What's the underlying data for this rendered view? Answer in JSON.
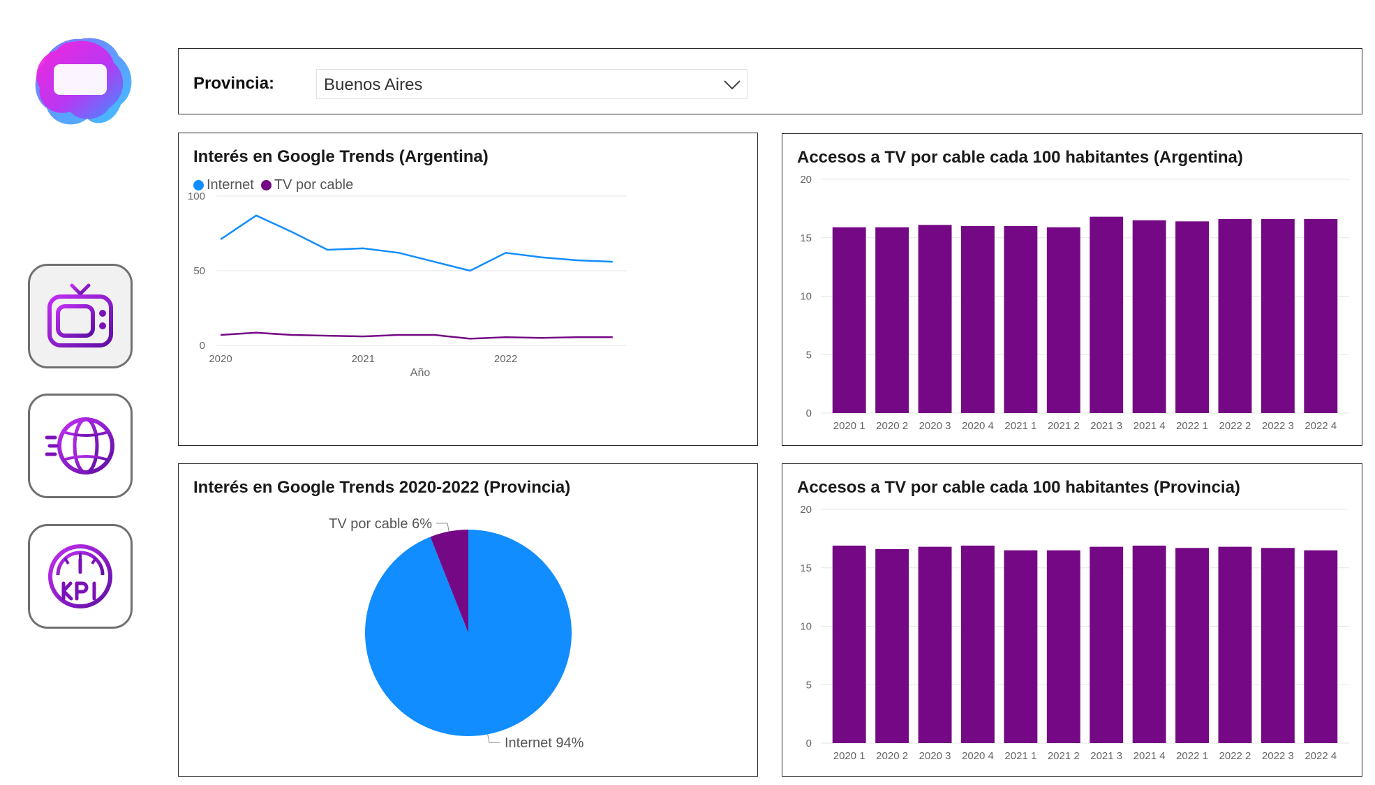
{
  "filter": {
    "label": "Provincia:",
    "selected": "Buenos Aires",
    "chevron_icon": "chevron-down-icon"
  },
  "nav": {
    "logo_icon": "app-logo",
    "items": [
      {
        "icon": "tv-icon",
        "active": true
      },
      {
        "icon": "globe-internet-icon",
        "active": false
      },
      {
        "icon": "kpi-gauge-icon",
        "active": false
      }
    ]
  },
  "colors": {
    "internet": "#118dff",
    "tv": "#750985",
    "accent_purple": "#8a1ec9"
  },
  "chart_data": [
    {
      "type": "line",
      "title": "Interés en Google Trends (Argentina)",
      "xlabel": "Año",
      "ylabel": "",
      "x_tick_labels": [
        "2020",
        "2021",
        "2022"
      ],
      "y_ticks": [
        0,
        50,
        100
      ],
      "ylim": [
        0,
        100
      ],
      "xlim": [
        2020,
        2022.8
      ],
      "legend": "top-left",
      "grid": true,
      "x": [
        2020,
        2020.25,
        2020.5,
        2020.75,
        2021,
        2021.25,
        2021.5,
        2021.75,
        2022,
        2022.25,
        2022.5,
        2022.75
      ],
      "series": [
        {
          "name": "Internet",
          "color": "#118dff",
          "values": [
            71,
            87,
            76,
            64,
            65,
            62,
            56,
            50,
            62,
            59,
            57,
            56
          ]
        },
        {
          "name": "TV por cable",
          "color": "#750985",
          "values": [
            7,
            8.5,
            7,
            6.5,
            6,
            7,
            7,
            4.5,
            5.5,
            5,
            5.5,
            5.5
          ]
        }
      ]
    },
    {
      "type": "bar",
      "title": "Accesos a TV por cable cada 100 habitantes (Argentina)",
      "xlabel": "",
      "ylabel": "",
      "y_ticks": [
        0,
        5,
        10,
        15,
        20
      ],
      "ylim": [
        0,
        20
      ],
      "grid": true,
      "color": "#750985",
      "categories": [
        "2020 1",
        "2020 2",
        "2020 3",
        "2020 4",
        "2021 1",
        "2021 2",
        "2021 3",
        "2021 4",
        "2022 1",
        "2022 2",
        "2022 3",
        "2022 4"
      ],
      "values": [
        15.9,
        15.9,
        16.1,
        16.0,
        16.0,
        15.9,
        16.8,
        16.5,
        16.4,
        16.6,
        16.6,
        16.6
      ]
    },
    {
      "type": "pie",
      "title": "Interés en Google Trends 2020-2022 (Provincia)",
      "slices": [
        {
          "label": "Internet",
          "value": 94,
          "display": "Internet 94%",
          "color": "#118dff"
        },
        {
          "label": "TV por cable",
          "value": 6,
          "display": "TV por cable 6%",
          "color": "#750985"
        }
      ]
    },
    {
      "type": "bar",
      "title": "Accesos a TV por cable cada 100 habitantes (Provincia)",
      "xlabel": "",
      "ylabel": "",
      "y_ticks": [
        0,
        5,
        10,
        15,
        20
      ],
      "ylim": [
        0,
        20
      ],
      "grid": true,
      "color": "#750985",
      "categories": [
        "2020 1",
        "2020 2",
        "2020 3",
        "2020 4",
        "2021 1",
        "2021 2",
        "2021 3",
        "2021 4",
        "2022 1",
        "2022 2",
        "2022 3",
        "2022 4"
      ],
      "values": [
        16.9,
        16.6,
        16.8,
        16.9,
        16.5,
        16.5,
        16.8,
        16.9,
        16.7,
        16.8,
        16.7,
        16.5
      ]
    }
  ]
}
